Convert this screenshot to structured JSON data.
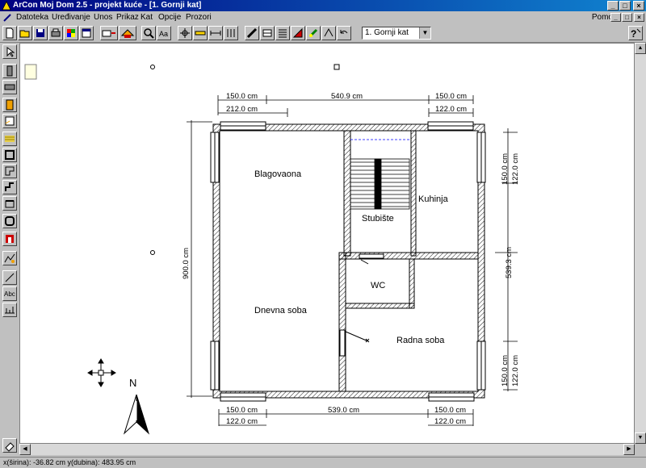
{
  "window": {
    "title": "ArCon Moj Dom  2.5 - projekt kuće - [1. Gornji kat]",
    "controls": [
      "_",
      "□",
      "×"
    ]
  },
  "menu": {
    "items": [
      "Datoteka",
      "Uređivanje",
      "Unos",
      "Prikaz",
      "Kat",
      "Opcije",
      "Prozori"
    ],
    "help": "Pomoć",
    "doc_controls": [
      "_",
      "□",
      "×"
    ]
  },
  "toolbar": {
    "floor_select": "1. Gornji kat"
  },
  "plan": {
    "rooms": {
      "blagovaona": "Blagovaona",
      "kuhinja": "Kuhinja",
      "stubiste": "Stubište",
      "wc": "WC",
      "dnevna": "Dnevna soba",
      "radna": "Radna soba"
    },
    "dims": {
      "top1_left": "150.0 cm",
      "top1_mid": "540.9 cm",
      "top1_right": "150.0 cm",
      "top2_left": "212.0 cm",
      "top2_right": "122.0 cm",
      "bot1_left": "150.0 cm",
      "bot1_mid": "539.0 cm",
      "bot1_right": "150.0 cm",
      "bot2_left": "122.0 cm",
      "bot2_right": "122.0 cm",
      "left_v": "900.0 cm",
      "right_v_top1": "150.0 cm",
      "right_v_top2": "122.0 cm",
      "right_v_mid": "539.3 cm",
      "right_v_bot1": "150.0 cm",
      "right_v_bot2": "122.0 cm"
    },
    "north": "N"
  },
  "status": {
    "coords": "x(širina): -36.82 cm  y(dubina): 483.95 cm"
  },
  "colors": {
    "title_start": "#000080",
    "title_end": "#1084d0"
  }
}
